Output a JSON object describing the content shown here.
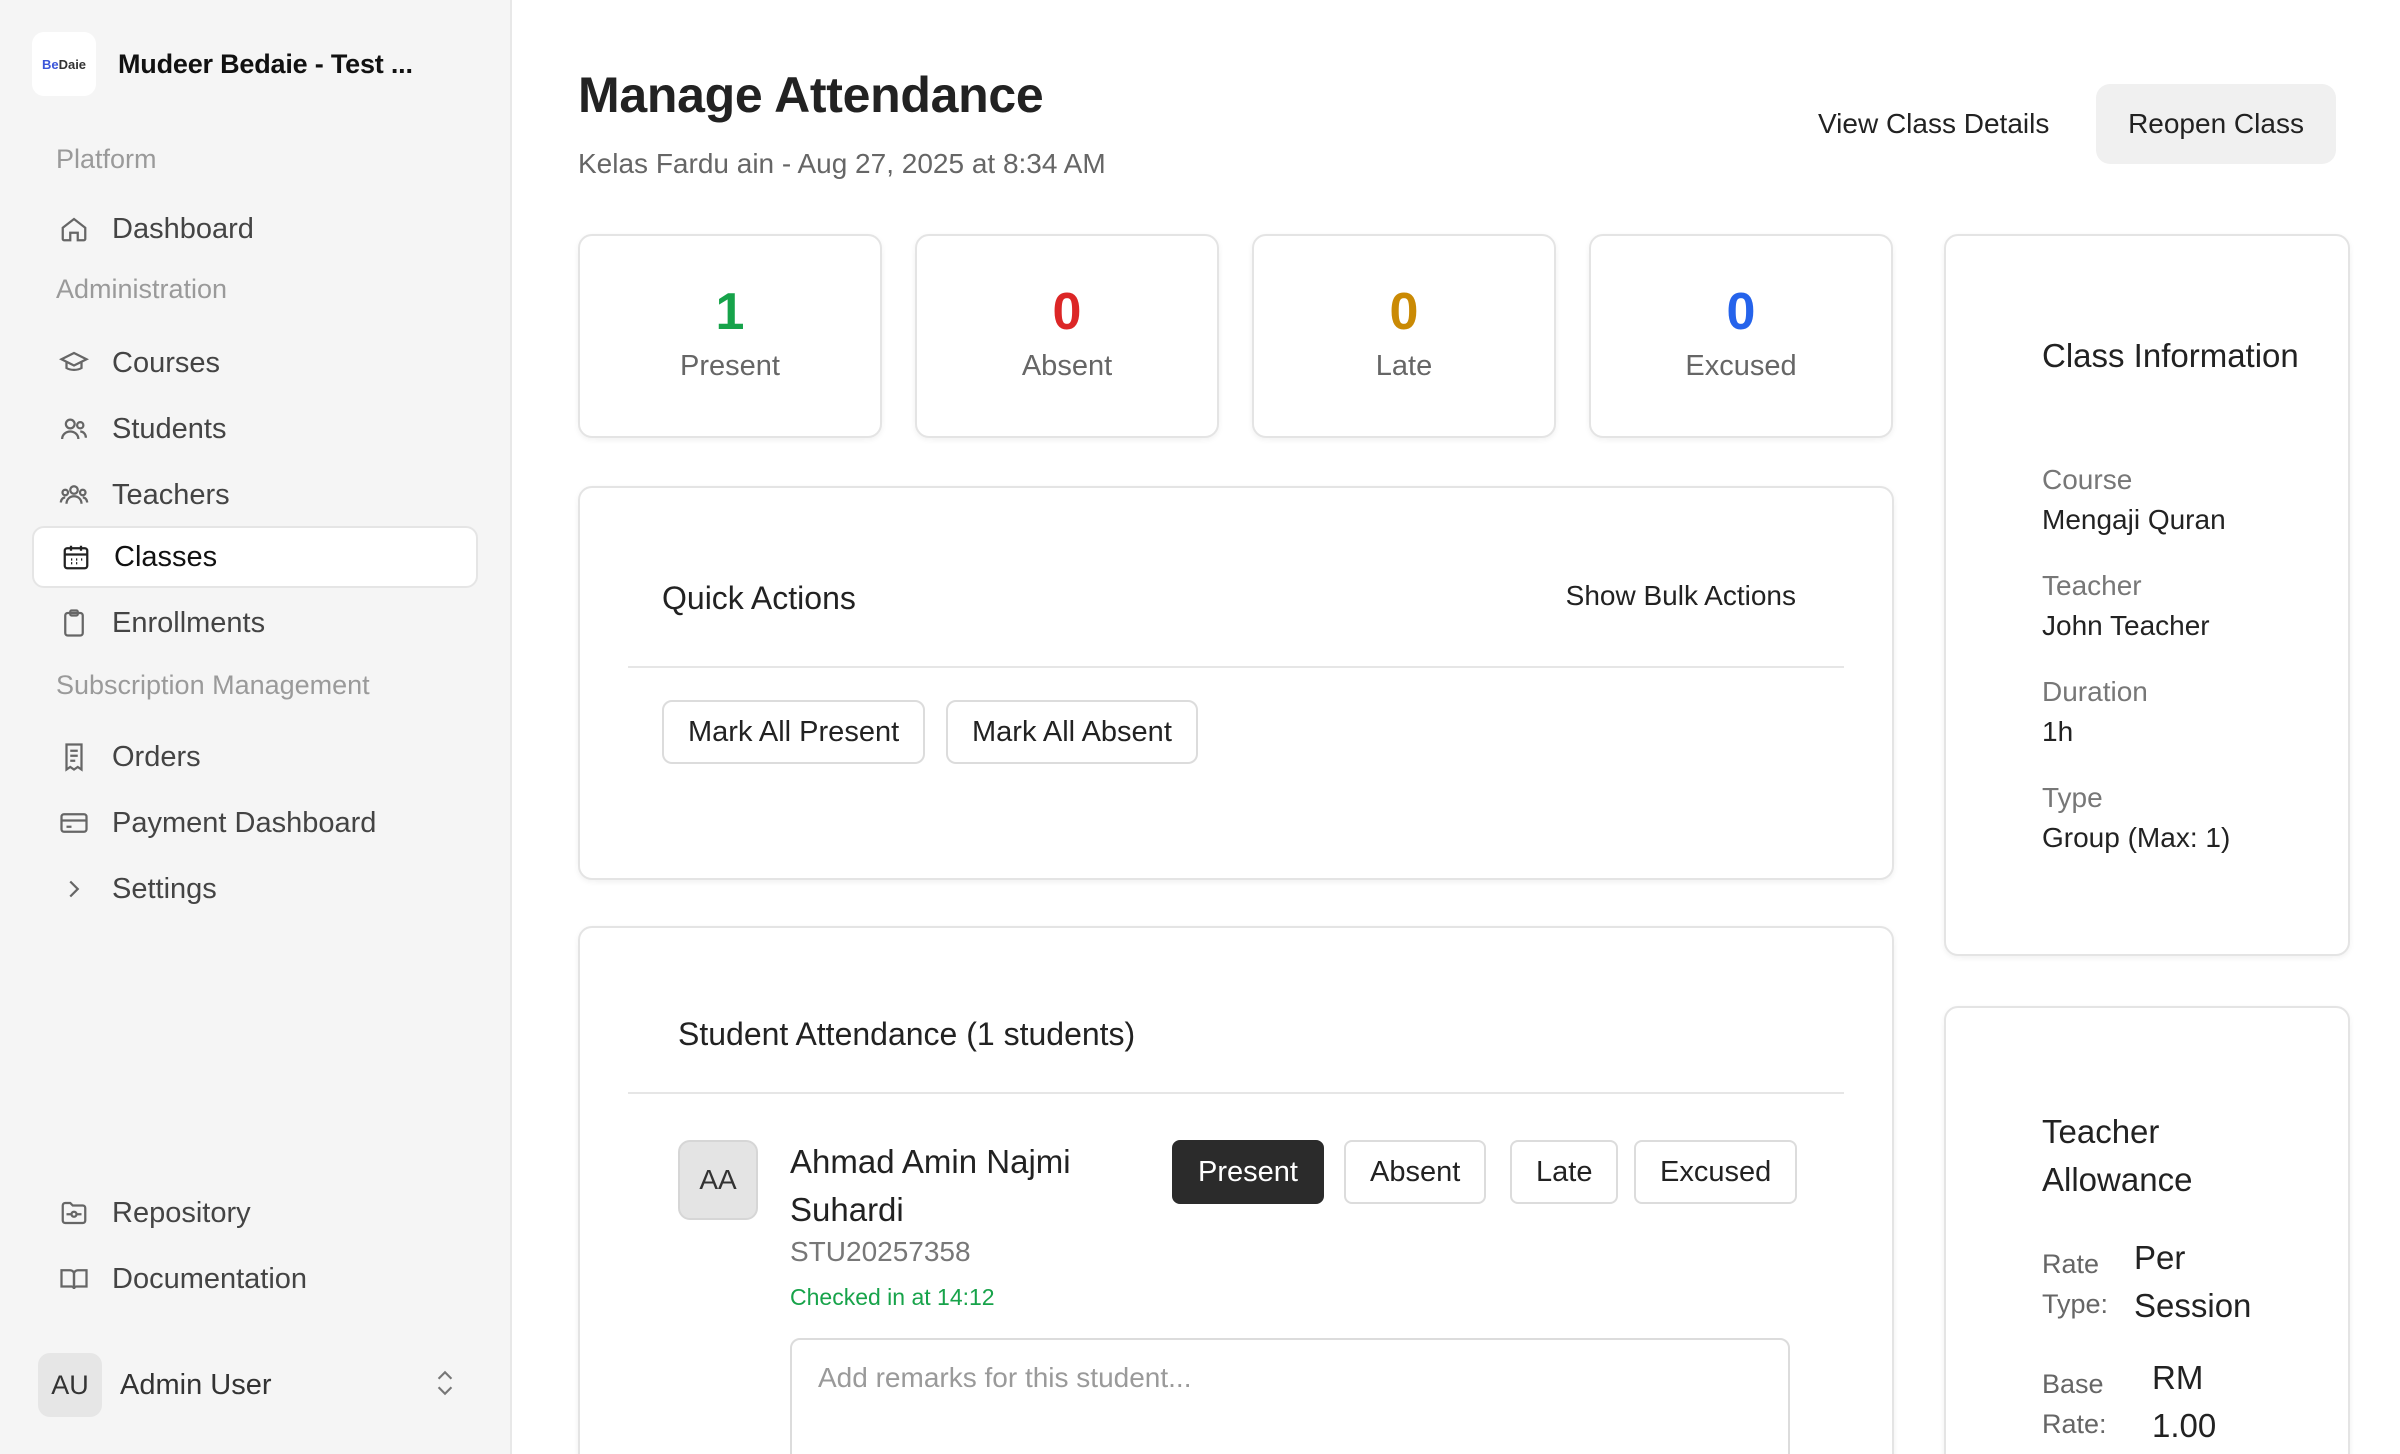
{
  "app": {
    "brand_name": "Mudeer Bedaie - Test ...",
    "logo_text_a": "Be",
    "logo_text_b": "Daie"
  },
  "sidebar": {
    "groups": {
      "platform": "Platform",
      "administration": "Administration",
      "subscription": "Subscription Management"
    },
    "items": [
      {
        "label": "Dashboard",
        "icon": "home-icon"
      },
      {
        "label": "Courses",
        "icon": "graduation-cap-icon"
      },
      {
        "label": "Students",
        "icon": "users-icon"
      },
      {
        "label": "Teachers",
        "icon": "user-group-icon"
      },
      {
        "label": "Classes",
        "icon": "calendar-icon",
        "active": true
      },
      {
        "label": "Enrollments",
        "icon": "clipboard-icon"
      },
      {
        "label": "Orders",
        "icon": "receipt-icon"
      },
      {
        "label": "Payment Dashboard",
        "icon": "credit-card-icon"
      },
      {
        "label": "Settings",
        "icon": "chevron-right-icon"
      }
    ],
    "footer_items": [
      {
        "label": "Repository",
        "icon": "folder-git-icon"
      },
      {
        "label": "Documentation",
        "icon": "book-open-icon"
      }
    ],
    "user": {
      "initials": "AU",
      "name": "Admin User"
    }
  },
  "header": {
    "title": "Manage Attendance",
    "subtitle": "Kelas Fardu ain - Aug 27, 2025 at 8:34 AM",
    "view_details_label": "View Class Details",
    "reopen_label": "Reopen Class"
  },
  "stats": [
    {
      "value": "1",
      "label": "Present",
      "color": "#16a34a"
    },
    {
      "value": "0",
      "label": "Absent",
      "color": "#dc2626"
    },
    {
      "value": "0",
      "label": "Late",
      "color": "#ca8a04"
    },
    {
      "value": "0",
      "label": "Excused",
      "color": "#2563eb"
    }
  ],
  "quick_actions": {
    "title": "Quick Actions",
    "toggle_label": "Show Bulk Actions",
    "mark_all_present": "Mark All Present",
    "mark_all_absent": "Mark All Absent"
  },
  "attendance": {
    "title": "Student Attendance (1 students)",
    "students": [
      {
        "initials": "AA",
        "name": "Ahmad Amin Najmi Suhardi",
        "student_id": "STU20257358",
        "checked_in": "Checked in at 14:12",
        "status": "Present",
        "remarks_placeholder": "Add remarks for this student..."
      }
    ],
    "status_options": [
      "Present",
      "Absent",
      "Late",
      "Excused"
    ]
  },
  "class_info": {
    "title": "Class Information",
    "course_label": "Course",
    "course": "Mengaji Quran",
    "teacher_label": "Teacher",
    "teacher": "John Teacher",
    "duration_label": "Duration",
    "duration": "1h",
    "type_label": "Type",
    "type": "Group (Max: 1)"
  },
  "allowance": {
    "title": "Teacher Allowance",
    "rate_type_label": "Rate Type:",
    "rate_type": "Per Session",
    "base_rate_label": "Base Rate:",
    "base_rate": "RM 1.00"
  }
}
